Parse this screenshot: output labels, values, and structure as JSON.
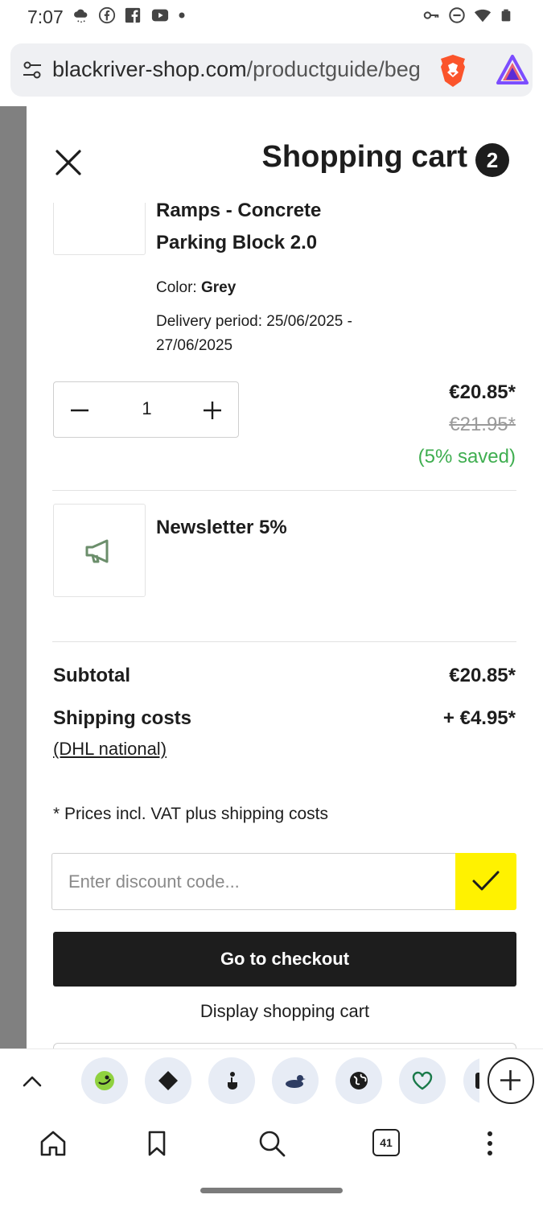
{
  "status_bar": {
    "time": "7:07"
  },
  "url_bar": {
    "url_host": "blackriver-shop.com",
    "url_path": "/productguide/beg"
  },
  "cart": {
    "title": "Shopping cart",
    "count": "2",
    "product": {
      "name_line1": "Ramps - Concrete",
      "name_line2": "Parking Block 2.0",
      "color_label": "Color:",
      "color_value": "Grey",
      "delivery_line1": "Delivery period: 25/06/2025 -",
      "delivery_line2": "27/06/2025",
      "quantity": "1",
      "price_now": "€20.85*",
      "price_old": "€21.95*",
      "price_saved": "(5% saved)"
    },
    "promo": {
      "name": "Newsletter 5%"
    },
    "summary": {
      "subtotal_label": "Subtotal",
      "subtotal_value": "€20.85*",
      "shipping_label": "Shipping costs",
      "shipping_value": "+ €4.95*",
      "shipping_method": "(DHL national)",
      "vat_note": "* Prices incl. VAT plus shipping costs"
    },
    "discount": {
      "placeholder": "Enter discount code..."
    },
    "checkout_label": "Go to checkout",
    "display_cart_label": "Display shopping cart"
  },
  "bottom_nav": {
    "tab_count": "41"
  },
  "colors": {
    "accent_yellow": "#fff200",
    "saved_green": "#3fae50",
    "primary_dark": "#1d1d1d"
  }
}
